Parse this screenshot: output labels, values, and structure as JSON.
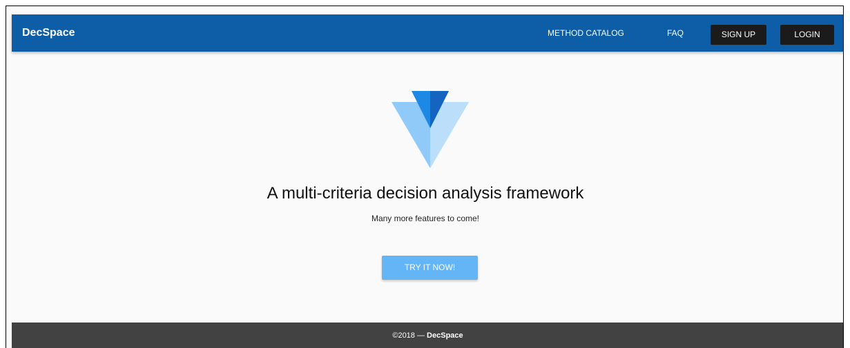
{
  "header": {
    "brand": "DecSpace",
    "nav": {
      "method_catalog": "METHOD CATALOG",
      "faq": "FAQ",
      "sign_up": "SIGN UP",
      "login": "LOGIN"
    },
    "color": "#0d5ea6"
  },
  "hero": {
    "logo_icon": "v-logo-icon",
    "headline": "A multi-criteria decision analysis framework",
    "subtitle": "Many more features to come!",
    "cta_label": "TRY IT NOW!",
    "cta_color": "#64b5f6"
  },
  "footer": {
    "copyright": "©2018 —",
    "brand": "DecSpace",
    "color": "#424242"
  }
}
